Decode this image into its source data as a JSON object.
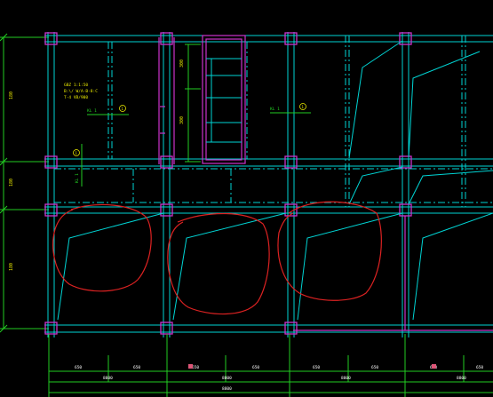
{
  "drawing": {
    "background": "#000000",
    "colors": {
      "grid": "#00d4d4",
      "column": "#cc33cc",
      "dimension": "#22cc22",
      "annotation": "#e8e800",
      "markup": "#dd2222",
      "dim_text": "#ffffff"
    },
    "labels": {
      "beam_note_1": "GBZ 1:1:50",
      "beam_note_1b": "B:\\/ W/A-B-8:C",
      "beam_note_1c": "T-4 VB/900",
      "tag_1": "KL 1",
      "tag_2": "KL 1",
      "tag_3": "KL 1",
      "circle_1": "1",
      "circle_2": "1",
      "circle_3": "1",
      "stair_dim": "300",
      "left_dim_1": "180",
      "left_dim_2": "180",
      "left_dim_3": "180",
      "bottom_dim_1": "650",
      "bottom_dim_2": "650",
      "bottom_dim_3": "650",
      "bottom_dim_4": "650",
      "bottom_dim_5": "650",
      "bottom_dim_6": "650",
      "bottom_dim_7": "650",
      "bottom_dim_8": "650",
      "bottom_total_1": "8800",
      "bottom_total_2": "8800",
      "bottom_total_3": "8800",
      "bottom_total_4": "8800",
      "bottom_total_5": "8800"
    }
  }
}
